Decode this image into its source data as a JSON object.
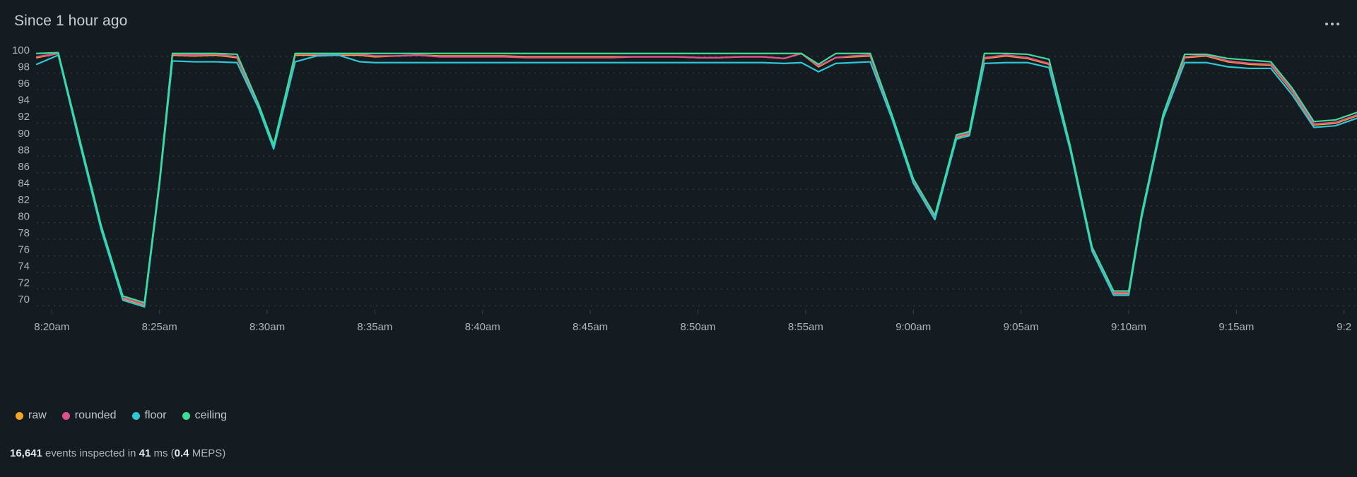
{
  "panel": {
    "title": "Since 1 hour ago",
    "menu_icon": "ellipsis-horizontal-icon",
    "background": "#151c21"
  },
  "footer": {
    "events_count": "16,641",
    "events_text": " events inspected in ",
    "duration": "41",
    "duration_unit": " ms (",
    "meps_value": "0.4",
    "meps_unit": " MEPS)",
    "full_text": "16,641 events inspected in 41 ms (0.4 MEPS)"
  },
  "legend": {
    "position": "bottom-left",
    "items": [
      {
        "label": "raw",
        "color": "#f5a623"
      },
      {
        "label": "rounded",
        "color": "#e0508f"
      },
      {
        "label": "floor",
        "color": "#2ec8d6"
      },
      {
        "label": "ceiling",
        "color": "#3ddc97"
      }
    ]
  },
  "chart_data": {
    "type": "line",
    "title": "Since 1 hour ago",
    "xlabel": "",
    "ylabel": "",
    "ylim": [
      69,
      100.6
    ],
    "yticks": [
      100,
      98,
      96,
      94,
      92,
      90,
      88,
      86,
      84,
      82,
      80,
      78,
      76,
      74,
      72,
      70
    ],
    "grid": true,
    "xlim": [
      "8:19am",
      "9:21am"
    ],
    "xticks": [
      "8:20am",
      "8:25am",
      "8:30am",
      "8:35am",
      "8:40am",
      "8:45am",
      "8:50am",
      "8:55am",
      "9:00am",
      "9:05am",
      "9:10am",
      "9:15am",
      "9:2"
    ],
    "x_minutes": [
      20,
      25,
      30,
      35,
      40,
      45,
      50,
      55,
      60,
      65,
      70,
      75,
      80
    ],
    "x_values": [
      19.3,
      20.3,
      21.3,
      22.3,
      23.3,
      24.3,
      25.0,
      25.6,
      26.6,
      27.6,
      28.6,
      29.6,
      30.3,
      31.3,
      32.3,
      33.3,
      34.3,
      35.0,
      36.0,
      37.0,
      38.0,
      39.0,
      40.0,
      41.0,
      42.0,
      43.0,
      44.0,
      45.0,
      46.0,
      47.0,
      48.0,
      49.0,
      50.0,
      51.0,
      52.0,
      53.0,
      54.0,
      54.8,
      55.6,
      56.4,
      57.2,
      58.0,
      59.0,
      60.0,
      61.0,
      62.0,
      62.6,
      63.3,
      64.3,
      65.3,
      66.3,
      67.3,
      68.3,
      69.3,
      70.0,
      70.6,
      71.6,
      72.6,
      73.6,
      74.6,
      75.6,
      76.6,
      77.6,
      78.6,
      79.6,
      80.6
    ],
    "series": [
      {
        "name": "raw",
        "color": "#f5a623",
        "note": "hidden behind rounded/floor/ceiling series",
        "values": [
          99.1,
          99.6,
          88.9,
          78.5,
          70.1,
          69.3,
          84.0,
          99.4,
          99.3,
          99.4,
          99.1,
          93.2,
          88.3,
          99.4,
          99.4,
          99.4,
          99.4,
          99.2,
          99.3,
          99.4,
          99.3,
          99.3,
          99.3,
          99.3,
          99.2,
          99.2,
          99.2,
          99.2,
          99.2,
          99.2,
          99.2,
          99.2,
          99.1,
          99.1,
          99.2,
          99.2,
          99.0,
          99.6,
          98.0,
          99.1,
          99.2,
          99.3,
          92.0,
          84.2,
          79.8,
          89.5,
          89.9,
          99.0,
          99.3,
          99.0,
          98.3,
          88.0,
          76.0,
          70.7,
          70.7,
          80.0,
          92.0,
          99.1,
          99.3,
          98.6,
          98.3,
          98.2,
          95.0,
          91.0,
          91.2,
          92.1
        ]
      },
      {
        "name": "rounded",
        "color": "#e0508f",
        "values": [
          99.2,
          99.6,
          89.0,
          78.6,
          70.2,
          69.4,
          84.1,
          99.5,
          99.4,
          99.5,
          99.2,
          93.3,
          88.4,
          99.5,
          99.5,
          99.5,
          99.5,
          99.3,
          99.3,
          99.4,
          99.2,
          99.2,
          99.2,
          99.2,
          99.1,
          99.1,
          99.1,
          99.1,
          99.1,
          99.2,
          99.2,
          99.2,
          99.1,
          99.1,
          99.2,
          99.2,
          99.0,
          99.6,
          98.1,
          99.1,
          99.3,
          99.4,
          92.1,
          84.3,
          79.9,
          89.6,
          90.0,
          99.1,
          99.4,
          99.1,
          98.4,
          88.1,
          76.1,
          70.8,
          70.8,
          80.1,
          92.1,
          99.2,
          99.4,
          98.7,
          98.4,
          98.3,
          95.1,
          91.1,
          91.3,
          92.2
        ]
      },
      {
        "name": "floor",
        "color": "#2ec8d6",
        "values": [
          98.3,
          99.4,
          88.7,
          78.3,
          69.9,
          69.1,
          83.8,
          98.7,
          98.6,
          98.6,
          98.5,
          93.0,
          88.1,
          98.6,
          99.3,
          99.4,
          98.6,
          98.5,
          98.5,
          98.5,
          98.5,
          98.5,
          98.5,
          98.5,
          98.5,
          98.5,
          98.5,
          98.5,
          98.5,
          98.5,
          98.5,
          98.5,
          98.5,
          98.5,
          98.5,
          98.5,
          98.4,
          98.5,
          97.4,
          98.4,
          98.5,
          98.6,
          91.8,
          84.0,
          79.6,
          89.3,
          89.7,
          98.4,
          98.5,
          98.5,
          97.9,
          87.8,
          75.8,
          70.5,
          70.5,
          79.8,
          91.8,
          98.5,
          98.5,
          98.0,
          97.8,
          97.8,
          94.6,
          90.7,
          90.9,
          91.8
        ]
      },
      {
        "name": "ceiling",
        "color": "#3ddc97",
        "values": [
          99.6,
          99.7,
          89.2,
          78.8,
          70.4,
          69.6,
          84.3,
          99.6,
          99.6,
          99.6,
          99.5,
          93.5,
          88.6,
          99.6,
          99.6,
          99.6,
          99.6,
          99.6,
          99.6,
          99.6,
          99.6,
          99.6,
          99.6,
          99.6,
          99.6,
          99.6,
          99.6,
          99.6,
          99.6,
          99.6,
          99.6,
          99.6,
          99.6,
          99.6,
          99.6,
          99.6,
          99.6,
          99.6,
          98.3,
          99.6,
          99.6,
          99.6,
          92.3,
          84.5,
          80.1,
          89.8,
          90.2,
          99.6,
          99.6,
          99.5,
          98.9,
          88.3,
          76.3,
          71.0,
          71.0,
          80.3,
          92.3,
          99.5,
          99.5,
          99.0,
          98.8,
          98.6,
          95.4,
          91.4,
          91.6,
          92.5
        ]
      }
    ]
  }
}
